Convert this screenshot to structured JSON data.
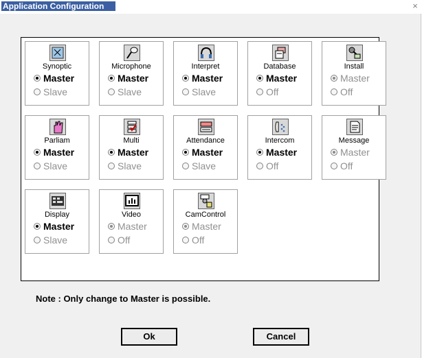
{
  "window": {
    "title": "Application Configuration",
    "close_glyph": "×"
  },
  "tiles": [
    {
      "name": "Synoptic",
      "icon": "synoptic-icon",
      "options": [
        "Master",
        "Slave"
      ],
      "selected": "Master",
      "enabled": true
    },
    {
      "name": "Microphone",
      "icon": "microphone-icon",
      "options": [
        "Master",
        "Slave"
      ],
      "selected": "Master",
      "enabled": true
    },
    {
      "name": "Interpret",
      "icon": "headphones-icon",
      "options": [
        "Master",
        "Slave"
      ],
      "selected": "Master",
      "enabled": true
    },
    {
      "name": "Database",
      "icon": "database-icon",
      "options": [
        "Master",
        "Off"
      ],
      "selected": "Master",
      "enabled": true
    },
    {
      "name": "Install",
      "icon": "install-icon",
      "options": [
        "Master",
        "Off"
      ],
      "selected": "Master",
      "enabled": false
    },
    {
      "name": "Parliam",
      "icon": "hand-icon",
      "options": [
        "Master",
        "Slave"
      ],
      "selected": "Master",
      "enabled": true
    },
    {
      "name": "Multi",
      "icon": "multi-icon",
      "options": [
        "Master",
        "Slave"
      ],
      "selected": "Master",
      "enabled": true
    },
    {
      "name": "Attendance",
      "icon": "attendance-icon",
      "options": [
        "Master",
        "Slave"
      ],
      "selected": "Master",
      "enabled": true
    },
    {
      "name": "Intercom",
      "icon": "intercom-icon",
      "options": [
        "Master",
        "Off"
      ],
      "selected": "Master",
      "enabled": true
    },
    {
      "name": "Message",
      "icon": "message-icon",
      "options": [
        "Master",
        "Off"
      ],
      "selected": "Master",
      "enabled": false
    },
    {
      "name": "Display",
      "icon": "display-icon",
      "options": [
        "Master",
        "Slave"
      ],
      "selected": "Master",
      "enabled": true
    },
    {
      "name": "Video",
      "icon": "video-icon",
      "options": [
        "Master",
        "Off"
      ],
      "selected": "Master",
      "enabled": false
    },
    {
      "name": "CamControl",
      "icon": "camera-icon",
      "options": [
        "Master",
        "Off"
      ],
      "selected": "Master",
      "enabled": false
    }
  ],
  "note": "Note : Only change to Master is possible.",
  "buttons": {
    "ok": "Ok",
    "cancel": "Cancel"
  }
}
